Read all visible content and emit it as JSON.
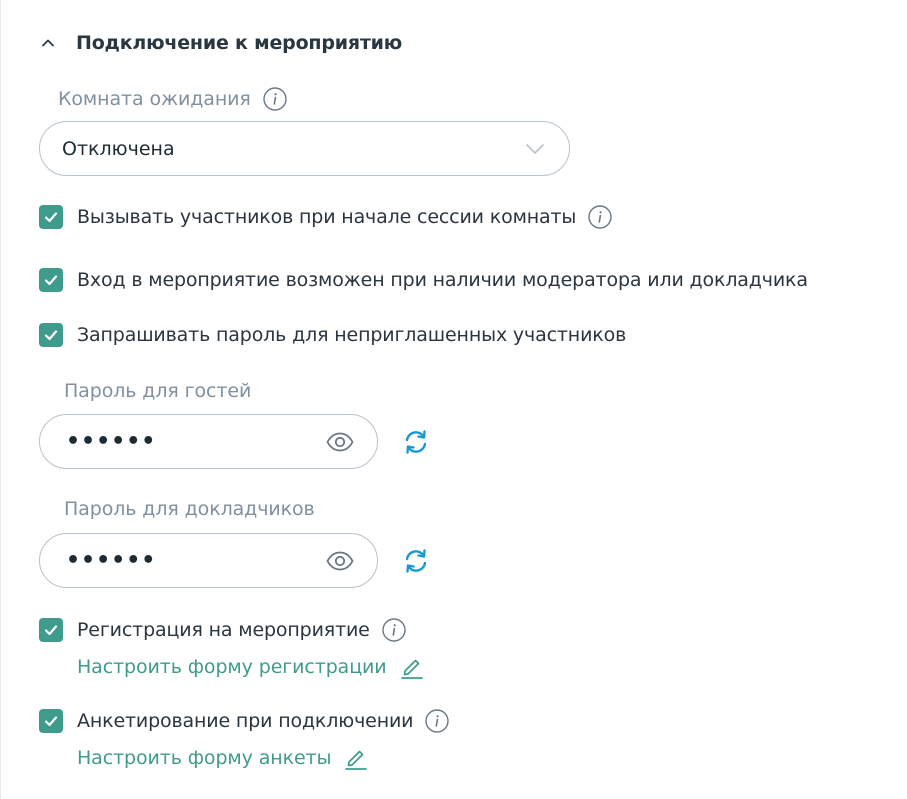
{
  "section": {
    "title": "Подключение к мероприятию"
  },
  "waiting_room": {
    "label": "Комната ожидания",
    "value": "Отключена"
  },
  "options": {
    "call_participants": {
      "label": "Вызывать участников при начале сессии комнаты",
      "checked": true
    },
    "moderator_required": {
      "label": "Вход в мероприятие возможен при наличии модератора или докладчика",
      "checked": true
    },
    "ask_password": {
      "label": "Запрашивать пароль для неприглашенных участников",
      "checked": true
    },
    "registration": {
      "label": "Регистрация на мероприятие",
      "checked": true,
      "link": "Настроить форму регистрации"
    },
    "survey": {
      "label": "Анкетирование при подключении",
      "checked": true,
      "link": "Настроить форму анкеты"
    }
  },
  "guest_password": {
    "label": "Пароль для гостей",
    "value": "••••••"
  },
  "speaker_password": {
    "label": "Пароль для докладчиков",
    "value": "••••••"
  },
  "colors": {
    "accent": "#3f9c8c",
    "refresh": "#1a98d6",
    "label_gray": "#8090a0",
    "border": "#b9c3cc"
  }
}
